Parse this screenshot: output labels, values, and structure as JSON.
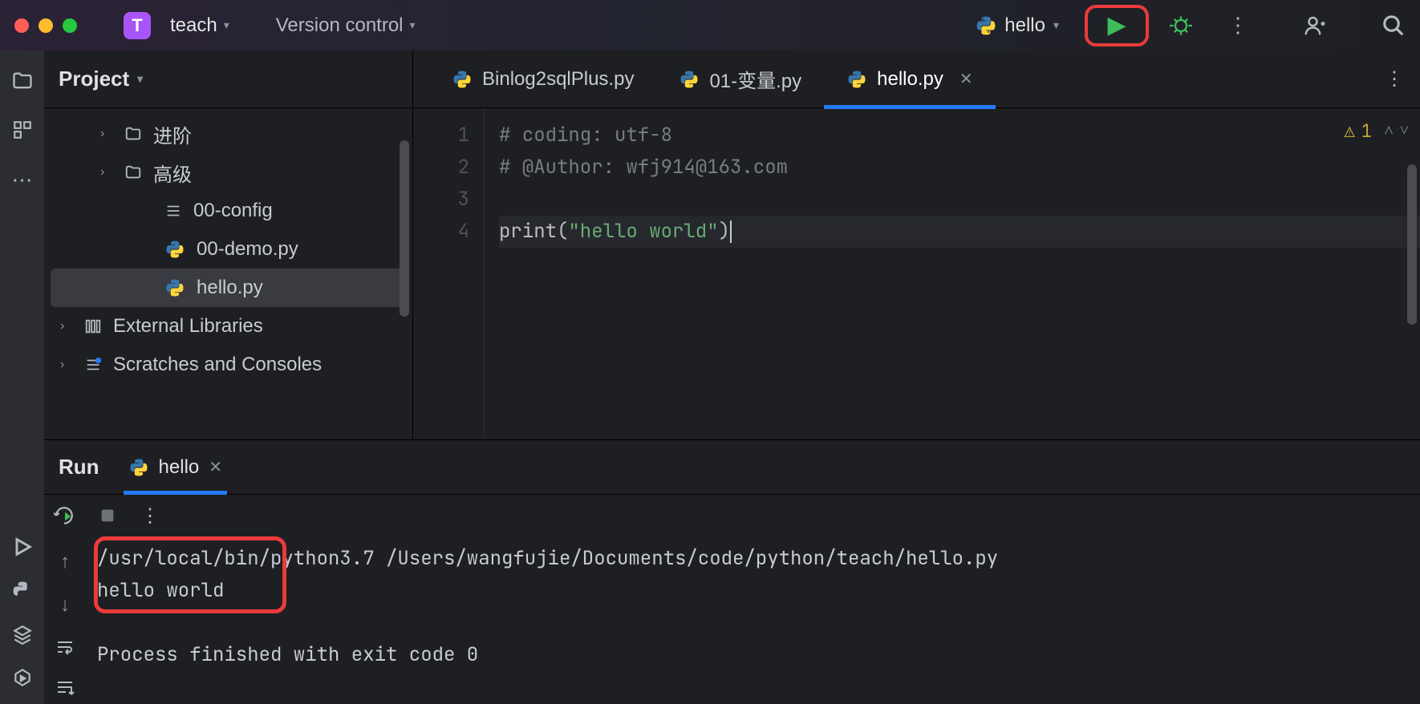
{
  "titlebar": {
    "project_badge": "T",
    "project_name": "teach",
    "version_control": "Version control",
    "run_config": "hello"
  },
  "project_panel": {
    "title": "Project",
    "items": [
      {
        "label": "进阶",
        "type": "folder",
        "indent": 1,
        "arrow": true
      },
      {
        "label": "高级",
        "type": "folder",
        "indent": 1,
        "arrow": true
      },
      {
        "label": "00-config",
        "type": "config",
        "indent": 2
      },
      {
        "label": "00-demo.py",
        "type": "py",
        "indent": 2
      },
      {
        "label": "hello.py",
        "type": "py",
        "indent": 2,
        "selected": true
      },
      {
        "label": "External Libraries",
        "type": "lib",
        "indent": 0,
        "arrow": true
      },
      {
        "label": "Scratches and Consoles",
        "type": "scratch",
        "indent": 0,
        "arrow": true
      }
    ]
  },
  "tabs": [
    {
      "label": "Binlog2sqlPlus.py",
      "active": false,
      "closable": false
    },
    {
      "label": "01-变量.py",
      "active": false,
      "closable": false
    },
    {
      "label": "hello.py",
      "active": true,
      "closable": true
    }
  ],
  "editor": {
    "warnings": "1",
    "lines": [
      {
        "n": "1",
        "html": "<span class='cm'># coding: utf-8</span>"
      },
      {
        "n": "2",
        "html": "<span class='cm'># @Author: wfj914@163.com</span>"
      },
      {
        "n": "3",
        "html": ""
      },
      {
        "n": "4",
        "html": "<span class='fn'>print</span><span class='br'>(</span><span class='str'>\"hello world\"</span><span class='br'>)</span><span class='cursor'></span>",
        "current": true
      }
    ]
  },
  "run": {
    "title": "Run",
    "tab": "hello",
    "console": [
      "/usr/local/bin/python3.7 /Users/wangfujie/Documents/code/python/teach/hello.py",
      "hello world",
      "",
      "Process finished with exit code 0"
    ]
  }
}
